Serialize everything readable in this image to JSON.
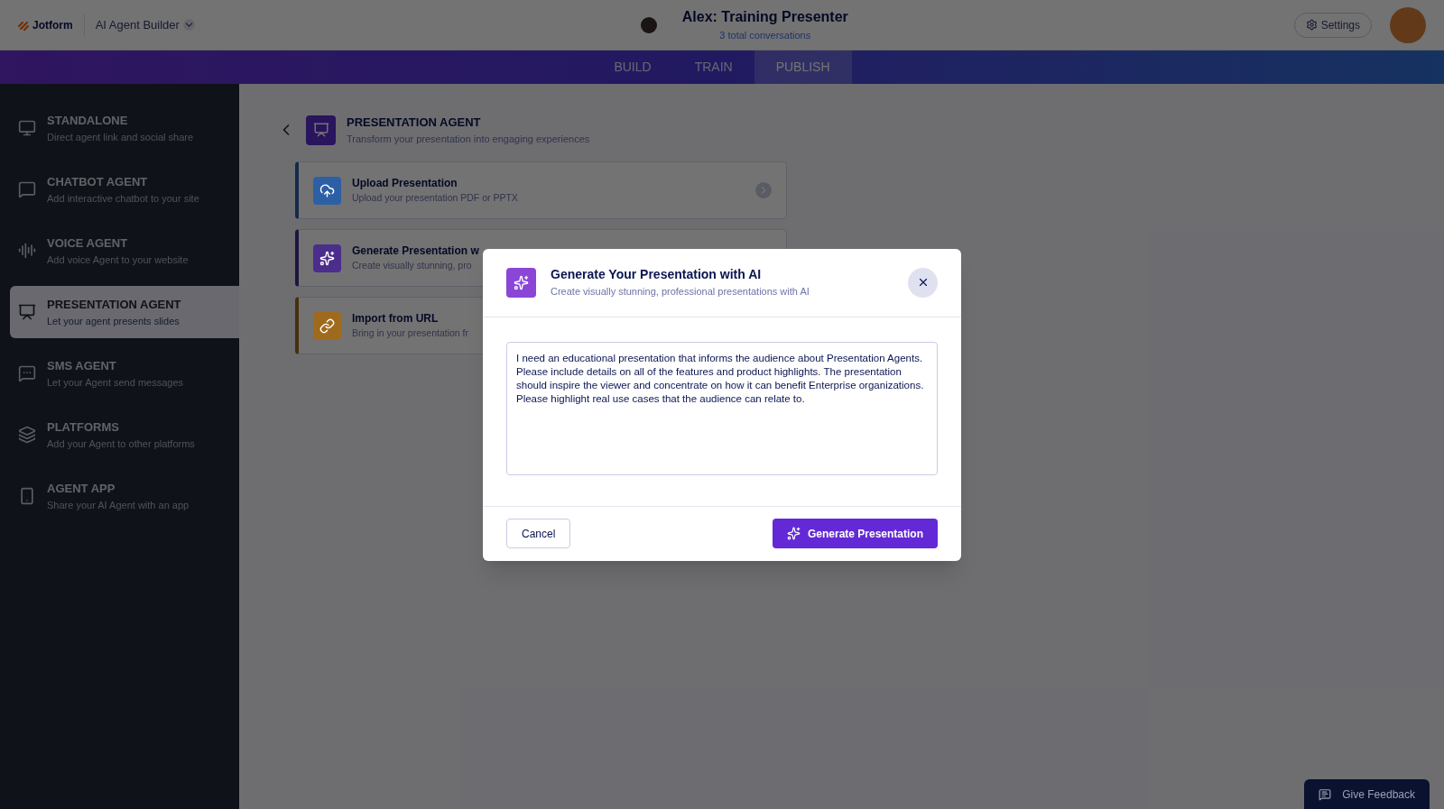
{
  "header": {
    "logo": "Jotform",
    "app_name": "AI Agent Builder",
    "agent_title": "Alex: Training Presenter",
    "conversations": "3 total conversations",
    "settings": "Settings"
  },
  "tabs": [
    {
      "label": "BUILD",
      "selected": false
    },
    {
      "label": "TRAIN",
      "selected": false
    },
    {
      "label": "PUBLISH",
      "selected": true
    }
  ],
  "sidebar": {
    "items": [
      {
        "title": "STANDALONE",
        "description": "Direct agent link and social share",
        "selected": false
      },
      {
        "title": "CHATBOT AGENT",
        "description": "Add interactive chatbot to your site",
        "selected": false
      },
      {
        "title": "VOICE AGENT",
        "description": "Add voice Agent to your website",
        "selected": false
      },
      {
        "title": "PRESENTATION AGENT",
        "description": "Let your agent presents slides",
        "selected": true
      },
      {
        "title": "SMS AGENT",
        "description": "Let your Agent send messages",
        "selected": false
      },
      {
        "title": "PLATFORMS",
        "description": "Add your Agent to other platforms",
        "selected": false
      },
      {
        "title": "AGENT APP",
        "description": "Share your AI Agent with an app",
        "selected": false
      }
    ]
  },
  "page": {
    "title": "PRESENTATION AGENT",
    "subtitle": "Transform your presentation into engaging experiences",
    "cards": [
      {
        "title": "Upload Presentation",
        "description": "Upload your presentation PDF or PPTX",
        "color": "#2d5fa5"
      },
      {
        "title": "Generate Presentation w",
        "description": "Create visually stunning, pro",
        "color": "#4b2d8c"
      },
      {
        "title": "Import from URL",
        "description": "Bring in your presentation fr",
        "color": "#a06a1e"
      }
    ]
  },
  "modal": {
    "title": "Generate Your Presentation with AI",
    "subtitle": "Create visually stunning, professional presentations with AI",
    "prompt": "I need an educational presentation that informs the audience about Presentation Agents. Please include details on all of the features and product highlights. The presentation should inspire the viewer and concentrate on how it can benefit Enterprise organizations. Please highlight real use cases that the audience can relate to.",
    "cancel": "Cancel",
    "generate": "Generate Presentation"
  },
  "feedback": "Give Feedback"
}
